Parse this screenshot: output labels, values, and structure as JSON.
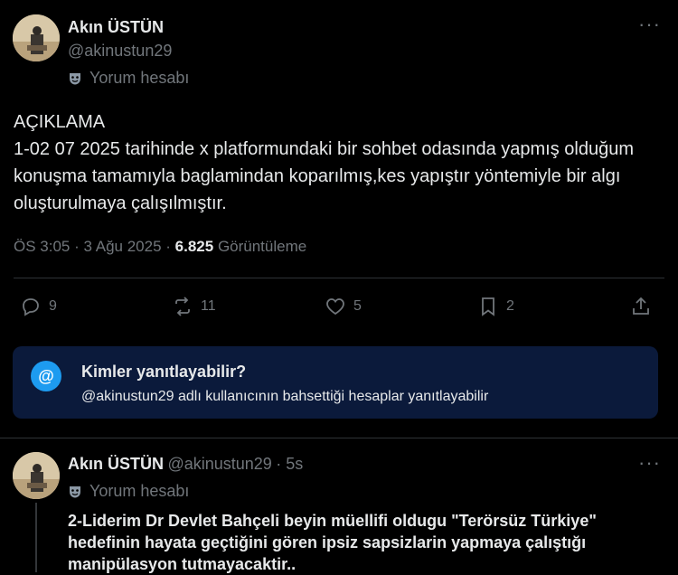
{
  "tweet": {
    "author_name": "Akın ÜSTÜN",
    "author_handle": "@akinustun29",
    "badge_label": "Yorum hesabı",
    "text": "AÇIKLAMA\n1-02 07 2025 tarihinde x platformundaki bir sohbet odasında yapmış olduğum konuşma tamamıyla baglamindan koparılmış,kes yapıştır yöntemiyle bir algı oluşturulmaya çalışılmıştır.",
    "time": "ÖS 3:05",
    "date": "3 Ağu 2025",
    "views_count": "6.825",
    "views_label": "Görüntüleme",
    "replies": "9",
    "reposts": "11",
    "likes": "5",
    "bookmarks": "2"
  },
  "reply_restriction": {
    "title": "Kimler yanıtlayabilir?",
    "subtitle": "@akinustun29 adlı kullanıcının bahsettiği hesaplar yanıtlayabilir",
    "icon_text": "@"
  },
  "reply": {
    "author_name": "Akın ÜSTÜN",
    "author_handle": "@akinustun29",
    "age": "5s",
    "badge_label": "Yorum hesabı",
    "text": "2-Liderim Dr Devlet Bahçeli beyin müellifi oldugu \"Terörsüz Türkiye\" hedefinin hayata geçtiğini gören ipsiz sapsizlarin yapmaya çalıştığı manipülasyon tutmayacaktir.."
  },
  "icons": [
    "more-icon",
    "mask-icon",
    "reply-icon",
    "repost-icon",
    "like-icon",
    "bookmark-icon",
    "share-icon",
    "at-icon"
  ],
  "colors": {
    "background": "#000000",
    "text": "#e7e9ea",
    "muted": "#71767b",
    "accent": "#1d9bf0",
    "reply_box": "#0b1a3b"
  }
}
